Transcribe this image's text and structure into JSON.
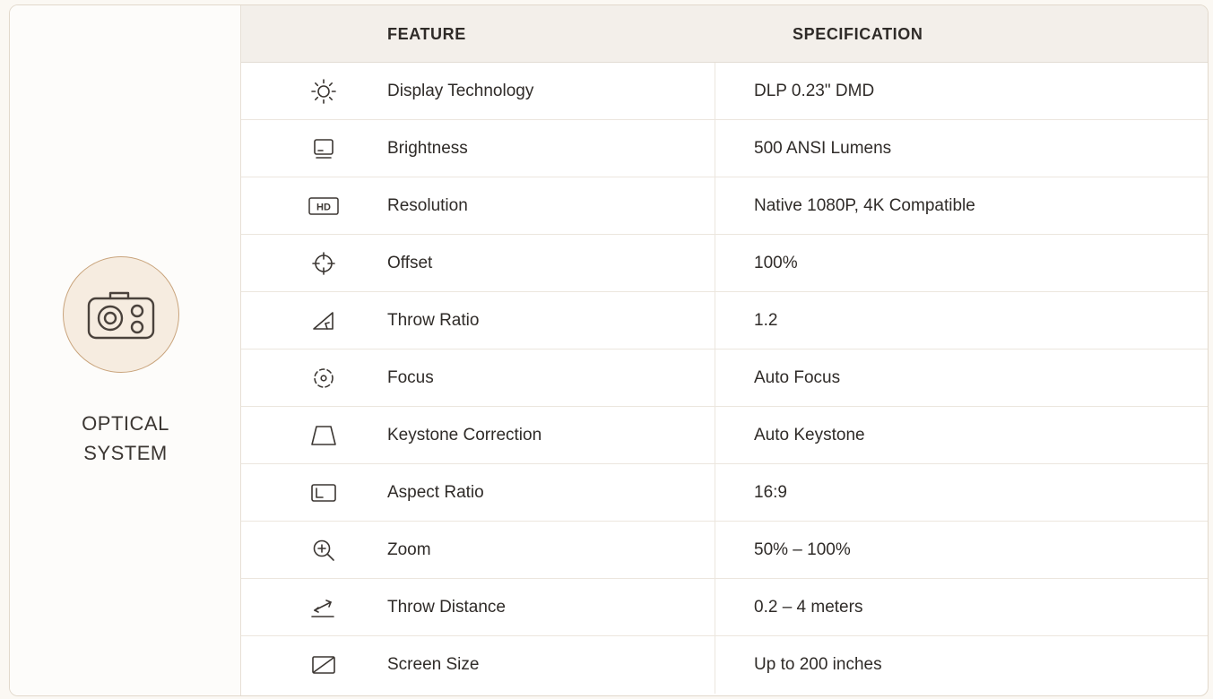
{
  "section": {
    "title_line1": "OPTICAL",
    "title_line2": "SYSTEM",
    "icon": "camera-icon",
    "accent_color": "#c9a47c"
  },
  "table": {
    "header_feature": "FEATURE",
    "header_spec": "SPECIFICATION",
    "rows": [
      {
        "icon": "sun-icon",
        "feature": "Display Technology",
        "spec": "DLP 0.23\" DMD"
      },
      {
        "icon": "monitor-icon",
        "feature": "Brightness",
        "spec": "500 ANSI Lumens"
      },
      {
        "icon": "hd-badge-icon",
        "feature": "Resolution",
        "spec": "Native 1080P, 4K Compatible"
      },
      {
        "icon": "crosshair-icon",
        "feature": "Offset",
        "spec": "100%"
      },
      {
        "icon": "angle-triangle-icon",
        "feature": "Throw Ratio",
        "spec": "1.2"
      },
      {
        "icon": "focus-target-icon",
        "feature": "Focus",
        "spec": "Auto Focus"
      },
      {
        "icon": "trapezoid-icon",
        "feature": "Keystone Correction",
        "spec": "Auto Keystone"
      },
      {
        "icon": "aspect-frame-icon",
        "feature": "Aspect Ratio",
        "spec": "16:9"
      },
      {
        "icon": "zoom-in-icon",
        "feature": "Zoom",
        "spec": "50% – 100%"
      },
      {
        "icon": "distance-arrows-icon",
        "feature": "Throw Distance",
        "spec": "0.2 – 4 meters"
      },
      {
        "icon": "screen-diagonal-icon",
        "feature": "Screen Size",
        "spec": "Up to 200 inches"
      }
    ]
  }
}
